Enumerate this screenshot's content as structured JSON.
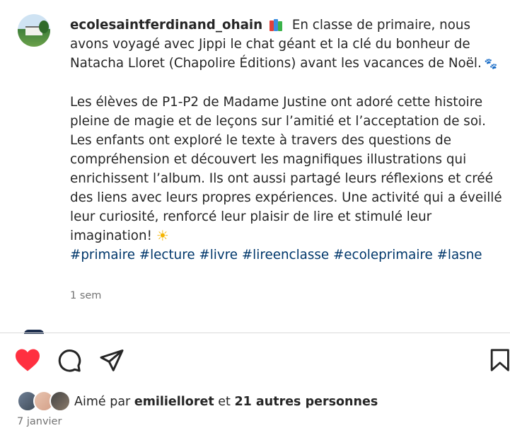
{
  "post": {
    "username": "ecolesaintferdinand_ohain",
    "caption_line1": "En classe de primaire, nous avons voyagé avec Jippi le chat géant et la clé du bonheur de Natacha Lloret (Chapolire Éditions) avant les vacances de Noël.",
    "caption_para2": "Les élèves de P1-P2 de Madame Justine ont adoré cette histoire pleine de magie et de leçons sur l’amitié et l’acceptation de soi. Les enfants ont exploré le texte à travers des questions de compréhension et découvert les magnifiques illustrations qui enrichissent l’album. Ils ont aussi partagé leurs réflexions et créé des liens avec leurs propres expériences. Une activité qui a éveillé leur curiosité, renforcé leur plaisir de lire et stimulé leur imagination!",
    "hashtags": "#primaire #lecture #livre #lireenclasse #ecoleprimaire #lasne",
    "time_ago": "1 sem",
    "emoji_books": "books-icon",
    "emoji_paws": "🐾",
    "emoji_sun": "☀"
  },
  "actions": {
    "like_icon": "heart-filled-icon",
    "like_color": "#ff3040",
    "comment_icon": "comment-icon",
    "share_icon": "send-icon",
    "save_icon": "bookmark-icon"
  },
  "likes": {
    "prefix": "Aimé par",
    "user": "emilielloret",
    "connector": "et",
    "others": "21 autres personnes"
  },
  "date": "7 janvier"
}
